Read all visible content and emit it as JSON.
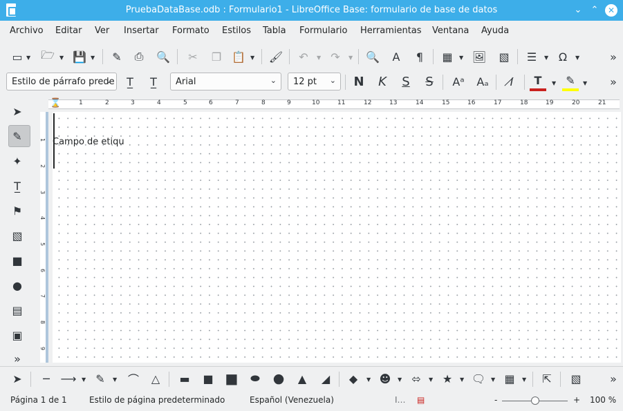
{
  "window": {
    "title": "PruebaDataBase.odb : Formulario1 - LibreOffice Base: formulario de base de datos"
  },
  "menu": [
    "Archivo",
    "Editar",
    "Ver",
    "Insertar",
    "Formato",
    "Estilos",
    "Tabla",
    "Formulario",
    "Herramientas",
    "Ventana",
    "Ayuda"
  ],
  "format_bar": {
    "paragraph_style": "Estilo de párrafo prede",
    "font_name": "Arial",
    "font_size": "12 pt",
    "bold_label": "N",
    "italic_label": "K",
    "underline_label": "S",
    "strike_label": "S"
  },
  "ruler": {
    "ticks": [
      "1",
      "2",
      "3",
      "4",
      "5",
      "6",
      "7",
      "8",
      "9",
      "10",
      "11",
      "12",
      "13",
      "14",
      "15",
      "16",
      "17",
      "18",
      "19",
      "20",
      "21"
    ]
  },
  "vruler": {
    "ticks": [
      "1",
      "2",
      "3",
      "4",
      "5",
      "6",
      "7",
      "8",
      "9"
    ]
  },
  "document": {
    "label_field_text": "Campo de etique"
  },
  "status": {
    "page": "Página 1 de 1",
    "page_style": "Estilo de página predeterminado",
    "language": "Español (Venezuela)",
    "zoom": "100 %",
    "zoom_minus": "-",
    "zoom_plus": "+"
  },
  "colors": {
    "accent": "#3daee9",
    "font_color": "#c9211e",
    "highlight": "#ffff00"
  }
}
